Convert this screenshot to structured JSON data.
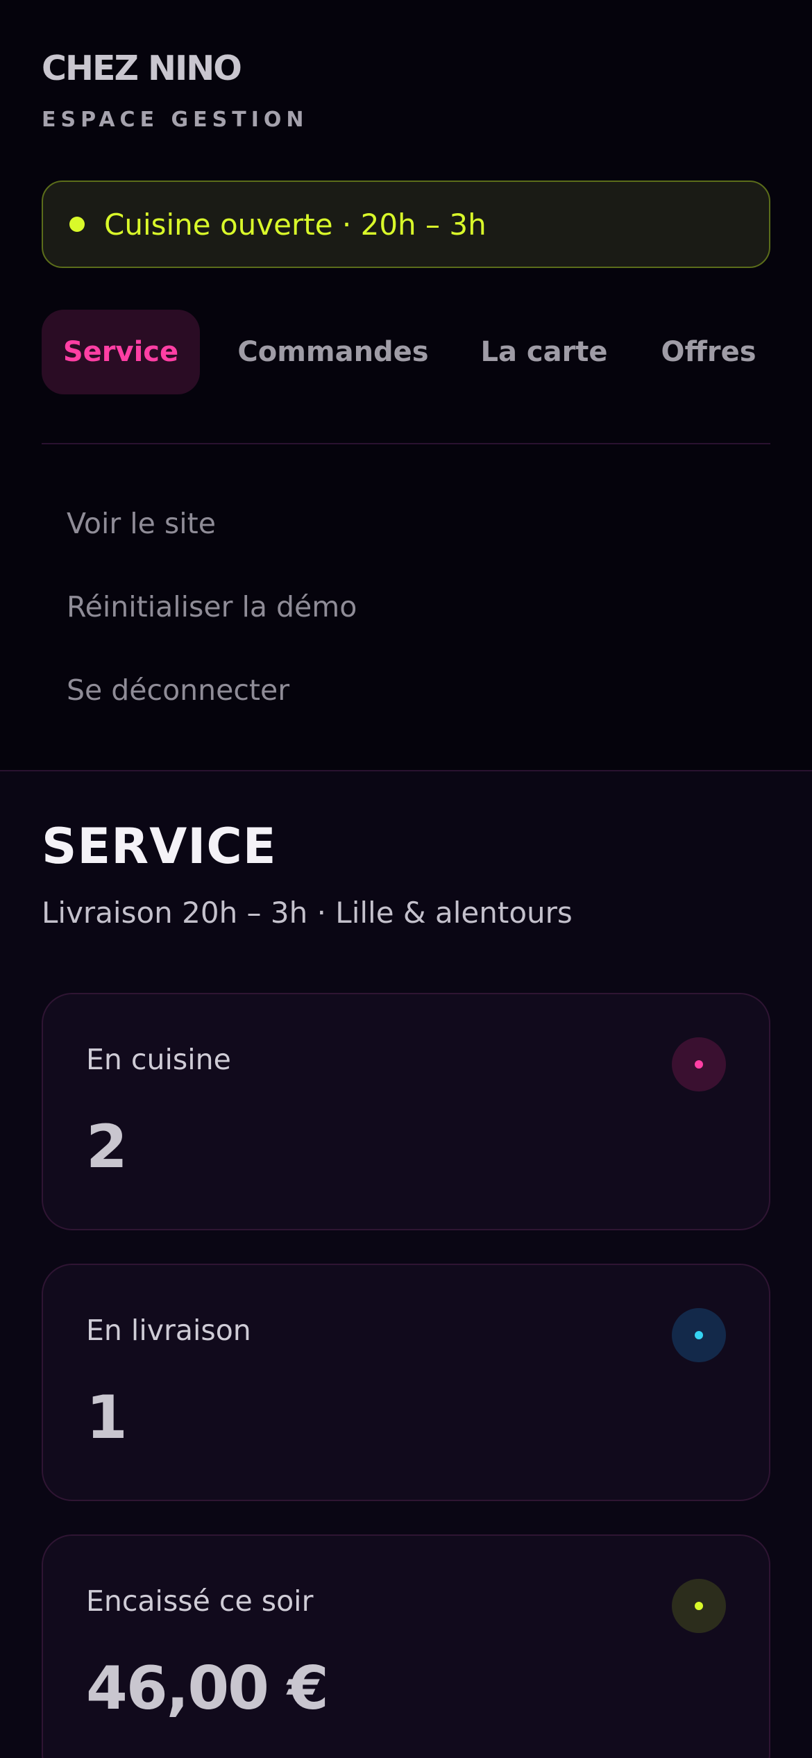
{
  "brand": {
    "name": "CHEZ NINO",
    "subtitle": "ESPACE GESTION"
  },
  "status": {
    "text": "Cuisine ouverte · 20h – 3h",
    "color": "#d9f92a"
  },
  "tabs": [
    {
      "label": "Service",
      "active": true
    },
    {
      "label": "Commandes",
      "active": false
    },
    {
      "label": "La carte",
      "active": false
    },
    {
      "label": "Offres",
      "active": false
    }
  ],
  "drawer_links": [
    {
      "label": "Voir le site"
    },
    {
      "label": "Réinitialiser la démo"
    },
    {
      "label": "Se déconnecter"
    }
  ],
  "main": {
    "title": "SERVICE",
    "subtitle": "Livraison 20h – 3h · Lille & alentours"
  },
  "stats": [
    {
      "label": "En cuisine",
      "value": "2",
      "icon": "pink-dot-icon",
      "color": "#ff3fa4"
    },
    {
      "label": "En livraison",
      "value": "1",
      "icon": "blue-dot-icon",
      "color": "#35d3f2"
    },
    {
      "label": "Encaissé ce soir",
      "value": "46,00 €",
      "icon": "lime-dot-icon",
      "color": "#d9f92a"
    }
  ],
  "colors": {
    "accent_pink": "#ff3fa4",
    "accent_lime": "#d9f92a",
    "background": "#0a0614"
  }
}
